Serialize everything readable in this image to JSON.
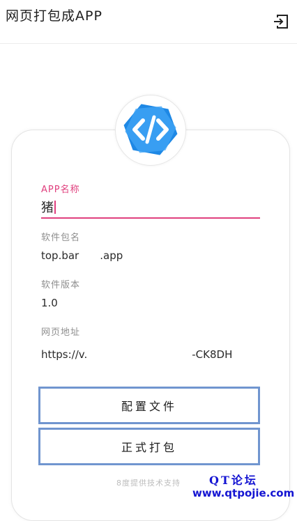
{
  "appbar": {
    "title": "网页打包成APP",
    "exit_icon": "exit-to-app-icon"
  },
  "logo": {
    "icon": "code-brackets-icon",
    "colors": [
      "#1e88e5",
      "#42a5f5"
    ]
  },
  "form": {
    "app_name": {
      "label": "APP名称",
      "value": "猪"
    },
    "package_name": {
      "label": "软件包名",
      "value": "top.bar  .app"
    },
    "version": {
      "label": "软件版本",
      "value": "1.0"
    },
    "url": {
      "label": "网页地址",
      "value": "https://v.          -CK8DH"
    }
  },
  "buttons": {
    "config": "配置文件",
    "build": "正式打包"
  },
  "footer": "8度提供技术支持",
  "watermark": {
    "line1": "QT论坛",
    "line2": "www.qtpojie.com"
  },
  "theme": {
    "accent": "#e0407e",
    "button_border": "#7095cf",
    "watermark": "#1414d2"
  }
}
